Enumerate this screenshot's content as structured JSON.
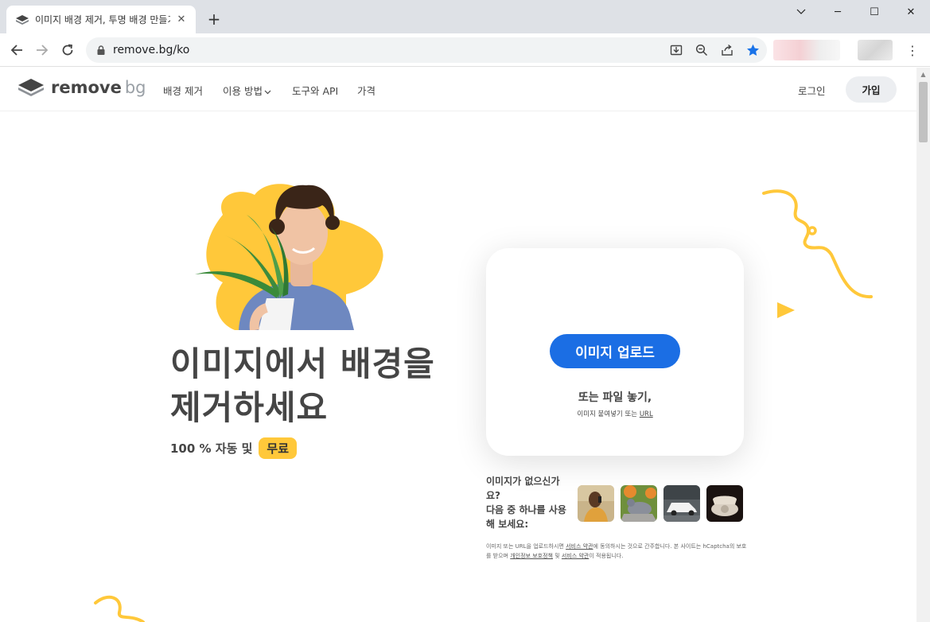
{
  "browser": {
    "tab_title": "이미지 배경 제거, 투명 배경 만들기",
    "tab_close": "✕",
    "new_tab": "+",
    "url": "remove.bg/ko",
    "window_controls": {
      "minimize": "─",
      "maximize": "☐",
      "close": "✕"
    },
    "icons": [
      "download-icon",
      "zoom-icon",
      "share-icon",
      "bookmark-star-icon",
      "menu-kebab-icon"
    ],
    "star_color": "#1a73e8"
  },
  "header": {
    "logo_main": "remove",
    "logo_bg": "bg",
    "nav": [
      "배경 제거",
      "이용 방법",
      "도구와 API",
      "가격"
    ],
    "nav_dropdown_chevron": "⌄",
    "login": "로그인",
    "signup": "가입"
  },
  "hero": {
    "headline_line1": "이미지에서 배경을",
    "headline_line2": "제거하세요",
    "subline": "100 % 자동 및",
    "free": "무료"
  },
  "upload": {
    "button": "이미지 업로드",
    "drop": "또는 파일 놓기,",
    "paste_prefix": "이미지 붙여넣기 또는",
    "paste_url": "URL"
  },
  "samples": {
    "prompt_line1": "이미지가 없으신가",
    "prompt_line2": "요?",
    "prompt_line3": "다음 중 하나를 사용",
    "prompt_line4": "해 보세요:",
    "thumbs": [
      "person-thumbnail",
      "pigeon-thumbnail",
      "car-thumbnail",
      "telephone-thumbnail"
    ]
  },
  "legal": {
    "part1": "이미지 또는 URL을 업로드하시면",
    "terms1": "서비스 약관",
    "part2": "에 동의하시는 것으로 간주합니다. 본 사이트는 hCaptcha의 보호를 받으며",
    "privacy": "개인정보 보호정책",
    "part3": "및",
    "terms2": "서비스 약관",
    "part4": "이 적용됩니다."
  },
  "colors": {
    "accent_blue": "#1b6ee4",
    "accent_yellow": "#ffc83a",
    "text": "#454545"
  }
}
